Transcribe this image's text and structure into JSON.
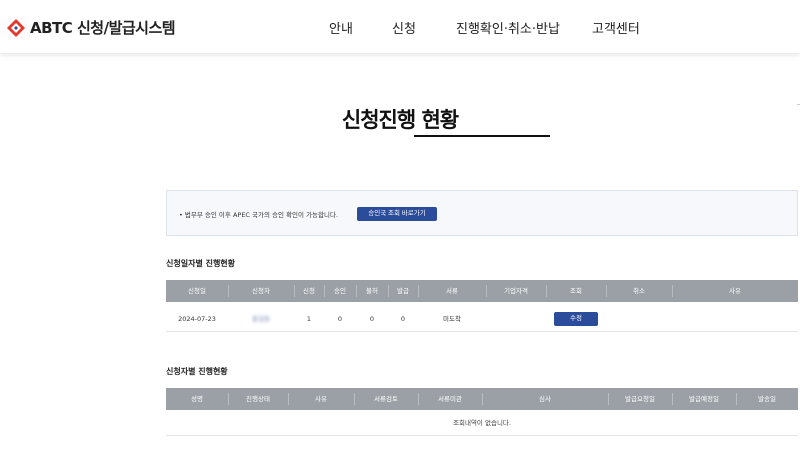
{
  "header": {
    "logo_text": "ABTC 신청/발급시스템",
    "nav": [
      "안내",
      "신청",
      "진행확인·취소·반납",
      "고객센터"
    ]
  },
  "page_title": "신청진행 현황",
  "notice": {
    "text": "• 법무부 승인 이후 APEC 국가의 승인 확인이 가능합니다.",
    "button": "승인국 조회 바로가기"
  },
  "by_date": {
    "title": "신청일자별 진행현황",
    "columns": [
      "신청일",
      "신청자",
      "신청",
      "승인",
      "불허",
      "발급",
      "서류",
      "기업자격",
      "조회",
      "취소",
      "사유"
    ],
    "rows": [
      {
        "date": "2024-07-23",
        "applicant": "홍길동",
        "apply": "1",
        "approved": "0",
        "denied": "0",
        "issued": "0",
        "docs": "미도착",
        "edit": "수정"
      }
    ]
  },
  "by_applicant": {
    "title": "신청자별 진행현황",
    "columns": [
      "성명",
      "진행상태",
      "사유",
      "서류검토",
      "서류미관",
      "심사",
      "발급요청일",
      "발급예정일",
      "발송일"
    ],
    "empty": "조회내역이 없습니다."
  },
  "colors": {
    "brand_red": "#e03a2f",
    "brand_blue": "#2b4c9a",
    "table_header": "#9aa0a6"
  }
}
